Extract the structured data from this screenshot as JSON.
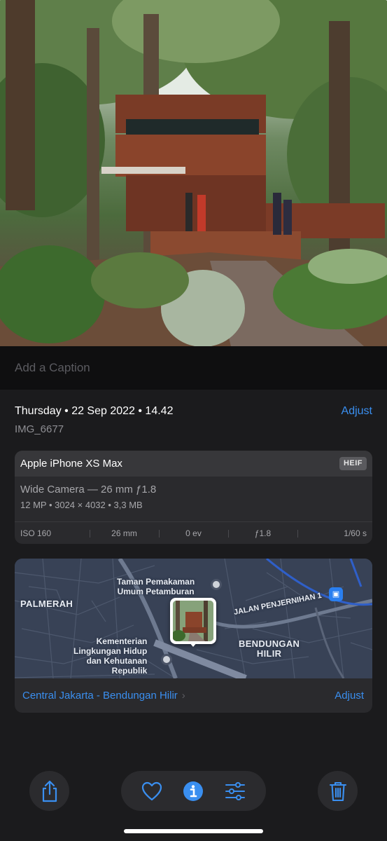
{
  "caption": {
    "placeholder": "Add a Caption"
  },
  "info": {
    "date_line": "Thursday • 22 Sep 2022 • 14.42",
    "filename": "IMG_6677",
    "adjust_label": "Adjust"
  },
  "device": {
    "name": "Apple iPhone XS Max",
    "format": "HEIF",
    "lens": "Wide Camera — 26 mm ƒ1.8",
    "specs": "12 MP  •  3024 × 4032  •  3,3 MB",
    "exif": [
      "ISO 160",
      "26 mm",
      "0 ev",
      "ƒ1.8",
      "1/60 s"
    ]
  },
  "map": {
    "labels": {
      "palmerah": "PALMERAH",
      "taman": "Taman Pemakaman\nUmum Petamburan",
      "jalan": "JALAN PENJERNIHAN 1",
      "bendungan": "BENDUNGAN\nHILIR",
      "kementerian": "Kementerian\nLingkungan Hidup\ndan Kehutanan\nRepublik"
    },
    "location": "Central Jakarta - Bendungan Hilir",
    "adjust_label": "Adjust"
  },
  "toolbar": {
    "share": "share-icon",
    "favorite": "heart-icon",
    "info": "info-icon",
    "edit": "sliders-icon",
    "delete": "trash-icon",
    "accent": "#3a8ff0"
  }
}
